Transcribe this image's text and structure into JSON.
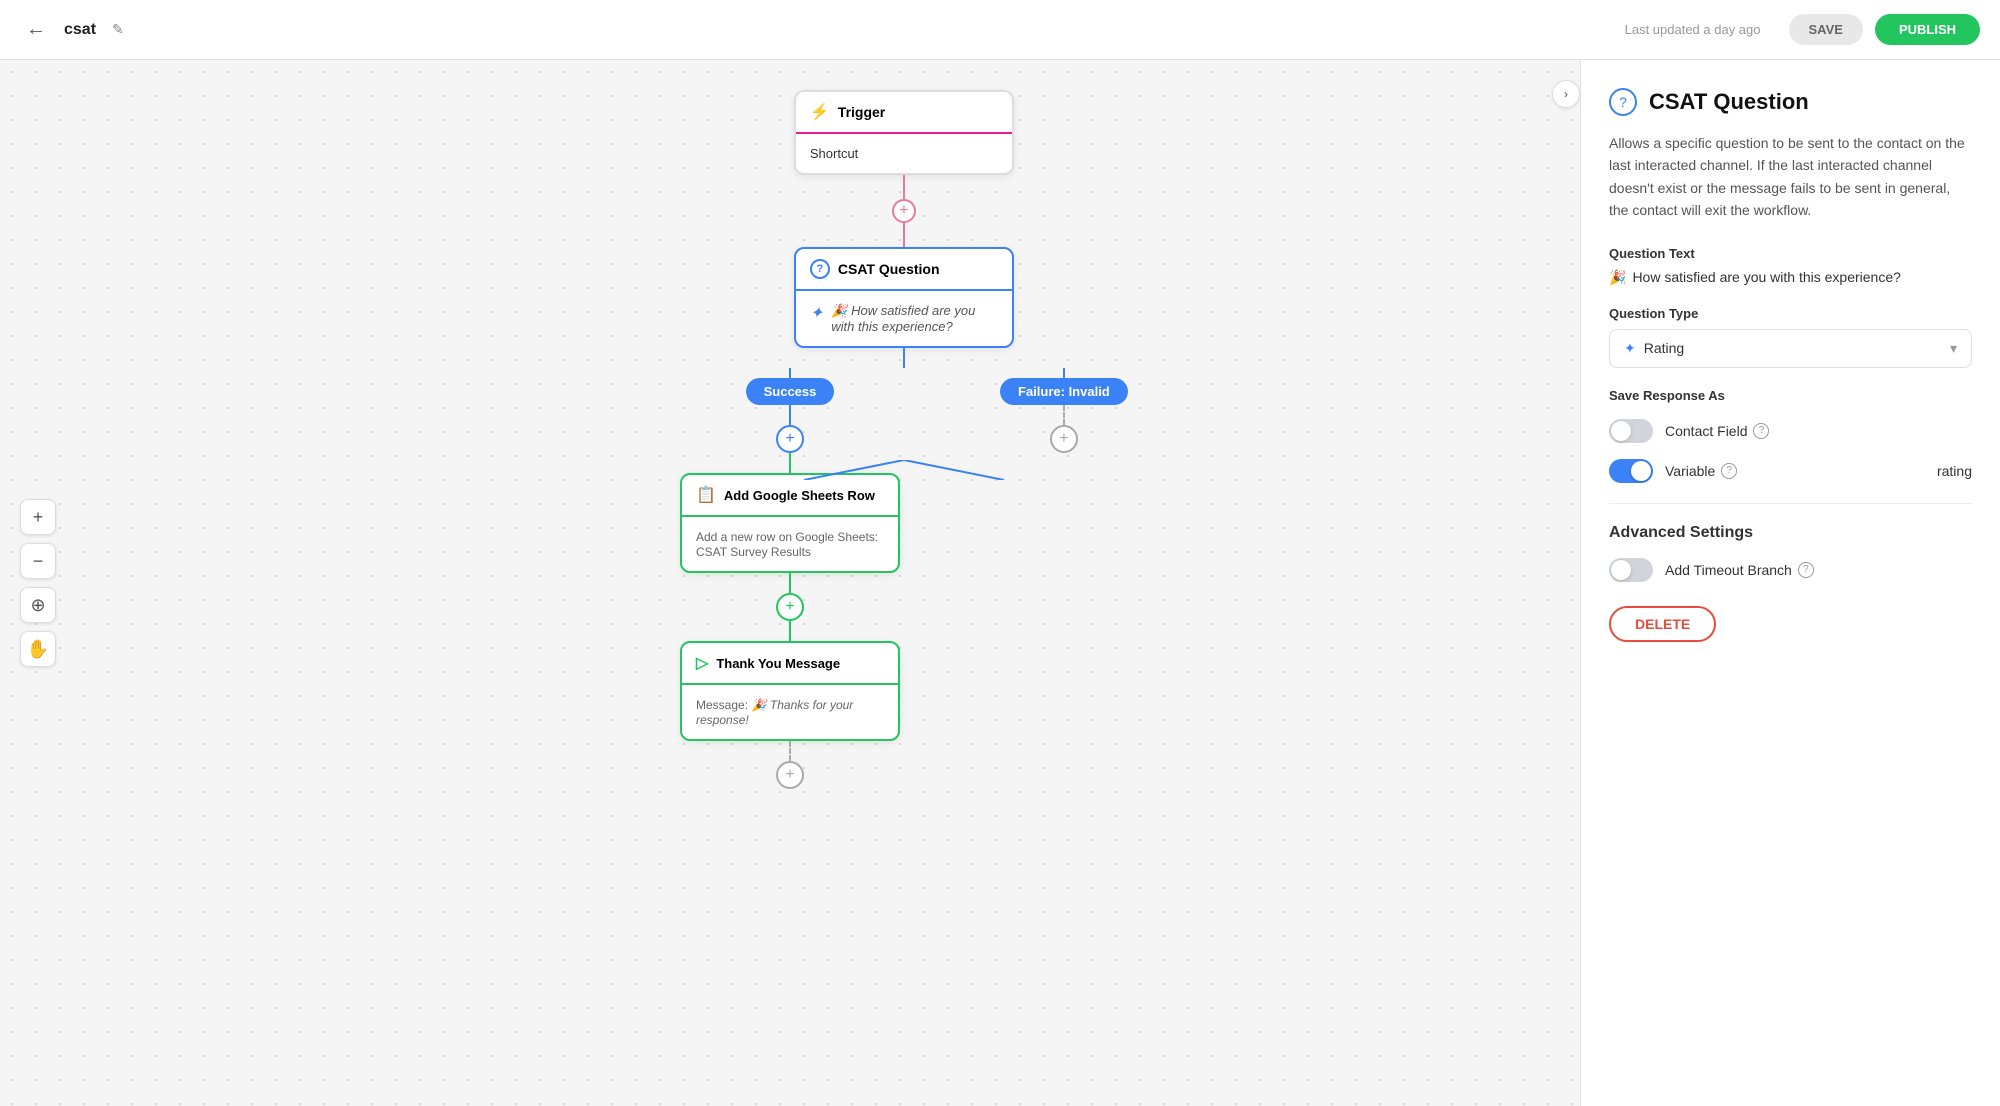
{
  "header": {
    "back_icon": "←",
    "title": "csat",
    "edit_icon": "✎",
    "updated_text": "Last updated a day ago",
    "save_label": "SAVE",
    "publish_label": "PUBLISH"
  },
  "canvas": {
    "collapse_icon": "›",
    "zoom_plus": "+",
    "zoom_minus": "−",
    "zoom_target": "⊕",
    "zoom_hand": "✋"
  },
  "flow": {
    "trigger_node": {
      "header_icon": "⚡",
      "header_label": "Trigger",
      "body_text": "Shortcut"
    },
    "csat_node": {
      "header_icon": "?",
      "header_label": "CSAT Question",
      "body_icon": "✦",
      "body_text": "🎉 How satisfied are you with this experience?"
    },
    "success_badge": "Success",
    "failure_badge": "Failure: Invalid",
    "sheets_node": {
      "header_icon": "📋",
      "header_label": "Add Google Sheets Row",
      "body_text": "Add a new row on Google Sheets: CSAT Survey Results"
    },
    "thankyou_node": {
      "header_icon": "▷",
      "header_label": "Thank You Message",
      "body_prefix": "Message:",
      "body_text": "🎉 Thanks for your response!"
    }
  },
  "right_panel": {
    "icon": "?",
    "title": "CSAT Question",
    "description": "Allows a specific question to be sent to the contact on the last interacted channel. If the last interacted channel doesn't exist or the message fails to be sent in general, the contact will exit the workflow.",
    "question_text_label": "Question Text",
    "question_text_icon": "🎉",
    "question_text_value": "How satisfied are you with this experience?",
    "question_type_label": "Question Type",
    "question_type_icon": "✦",
    "question_type_value": "Rating",
    "save_response_label": "Save Response As",
    "contact_field_label": "Contact Field",
    "contact_field_toggle": "off",
    "variable_label": "Variable",
    "variable_toggle": "on",
    "variable_value": "rating",
    "advanced_settings_label": "Advanced Settings",
    "timeout_branch_label": "Add Timeout Branch",
    "timeout_toggle": "off",
    "delete_label": "DELETE"
  }
}
